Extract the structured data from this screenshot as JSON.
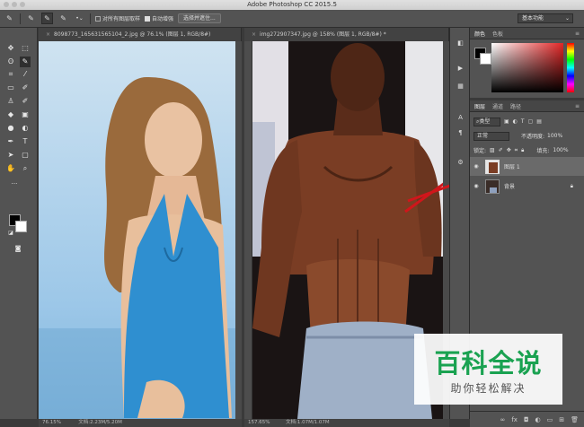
{
  "app": {
    "title": "Adobe Photoshop CC 2015.5"
  },
  "options_bar": {
    "sample_all_layers": "对所有图层取样",
    "auto_enhance": "自动增强",
    "select_and_mask": "选择并遮住...",
    "workspace": "基本功能"
  },
  "documents": [
    {
      "tab": "8098773_165631565104_2.jpg @ 76.1% (图层 1, RGB/8#)",
      "zoom": "76.15%",
      "doc_size": "文档:2.23M/5.20M"
    },
    {
      "tab": "img272907347.jpg @ 158% (图层 1, RGB/8#) *",
      "zoom": "157.65%",
      "doc_size": "文档:1.07M/1.07M"
    }
  ],
  "color_panel": {
    "tabs": [
      "颜色",
      "色板"
    ],
    "fg": "#000000",
    "bg": "#ffffff"
  },
  "layers_panel": {
    "tabs": [
      "图层",
      "通道",
      "路径"
    ],
    "filter_kind": "类型",
    "blend_mode": "正常",
    "opacity_label": "不透明度:",
    "opacity_value": "100%",
    "lock_label": "锁定:",
    "fill_label": "填充:",
    "fill_value": "100%",
    "layers": [
      {
        "name": "图层 1",
        "selected": true
      },
      {
        "name": "背景",
        "selected": false,
        "locked": true
      }
    ]
  },
  "watermark": {
    "title": "百科全说",
    "subtitle": "助你轻松解决",
    "color": "#1aa251"
  }
}
